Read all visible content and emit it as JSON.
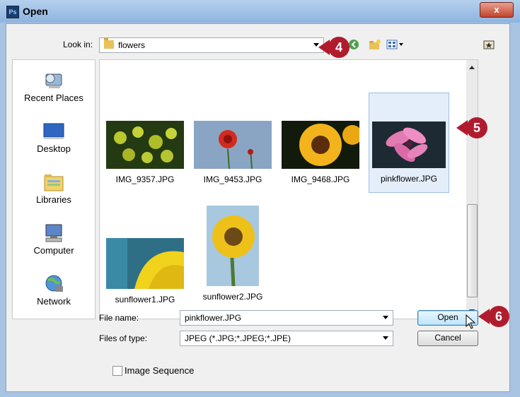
{
  "window": {
    "title": "Open",
    "app_icon_text": "Ps",
    "close_glyph": "x"
  },
  "lookin": {
    "label": "Look in:",
    "value": "flowers"
  },
  "places": [
    {
      "label": "Recent Places",
      "icon": "recent-places-icon"
    },
    {
      "label": "Desktop",
      "icon": "desktop-icon"
    },
    {
      "label": "Libraries",
      "icon": "libraries-icon"
    },
    {
      "label": "Computer",
      "icon": "computer-icon"
    },
    {
      "label": "Network",
      "icon": "network-icon"
    }
  ],
  "files": [
    {
      "name": "IMG_9357.JPG",
      "selected": false
    },
    {
      "name": "IMG_9453.JPG",
      "selected": false
    },
    {
      "name": "IMG_9468.JPG",
      "selected": false
    },
    {
      "name": "pinkflower.JPG",
      "selected": true
    },
    {
      "name": "sunflower1.JPG",
      "selected": false
    },
    {
      "name": "sunflower2.JPG",
      "selected": false
    }
  ],
  "filename": {
    "label": "File name:",
    "value": "pinkflower.JPG"
  },
  "filetype": {
    "label": "Files of type:",
    "value": "JPEG (*.JPG;*.JPEG;*.JPE)"
  },
  "buttons": {
    "open": "Open",
    "cancel": "Cancel"
  },
  "image_sequence": {
    "label": "Image Sequence",
    "checked": false
  },
  "callouts": {
    "c4": "4",
    "c5": "5",
    "c6": "6"
  },
  "colors": {
    "callout": "#b01c2e",
    "selection": "#e4eefa"
  }
}
